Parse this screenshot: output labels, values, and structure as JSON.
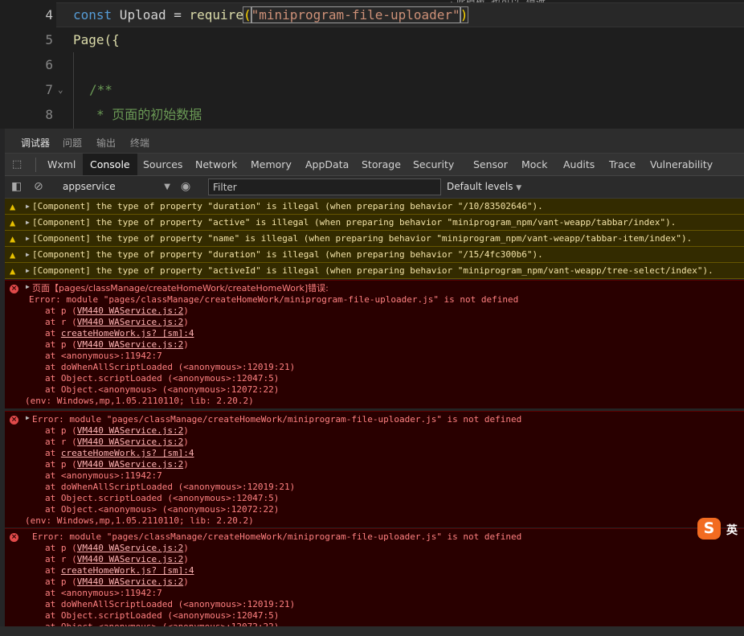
{
  "editor": {
    "top_hint": "· 此模板. 也可以. 值遮",
    "lines": [
      {
        "number": "4",
        "text_parts": [
          "const",
          " Upload",
          " = ",
          "require",
          "(",
          "\"miniprogram-file-uploader\"",
          ")"
        ]
      },
      {
        "number": "5",
        "text": "Page({"
      },
      {
        "number": "6",
        "text": ""
      },
      {
        "number": "7",
        "text": "/**"
      },
      {
        "number": "8",
        "text": "* 页面的初始数据"
      }
    ]
  },
  "panel_tabs": [
    "调试器",
    "问题",
    "输出",
    "终端"
  ],
  "devtools_tabs": [
    "Wxml",
    "Console",
    "Sources",
    "Network",
    "Memory",
    "AppData",
    "Storage",
    "Security",
    "Sensor",
    "Mock",
    "Audits",
    "Trace",
    "Vulnerability"
  ],
  "console_toolbar": {
    "context": "appservice",
    "filter_placeholder": "Filter",
    "levels": "Default levels"
  },
  "warnings": [
    "[Component] the type of property \"duration\" is illegal (when preparing behavior \"/10/83502646\").",
    "[Component] the type of property \"active\" is illegal (when preparing behavior \"miniprogram_npm/vant-weapp/tabbar/index\").",
    "[Component] the type of property \"name\" is illegal (when preparing behavior \"miniprogram_npm/vant-weapp/tabbar-item/index\").",
    "[Component] the type of property \"duration\" is illegal (when preparing behavior \"/15/4fc300b6\").",
    "[Component] the type of property \"activeId\" is illegal (when preparing behavior \"miniprogram_npm/vant-weapp/tree-select/index\")."
  ],
  "errors": {
    "first_header": "页面【pages/classManage/createHomeWork/createHomeWork]错误:",
    "message": "Error: module \"pages/classManage/createHomeWork/miniprogram-file-uploader.js\" is not defined",
    "stack": {
      "p1": "at p (VM440 WAService.js:2)",
      "r1": "at r (VM440 WAService.js:2)",
      "create": "at createHomeWork.js? [sm]:4",
      "p2": "at p (VM440 WAService.js:2)",
      "anon": "at <anonymous>:11942:7",
      "do_when": "at doWhenAllScriptLoaded (<anonymous>:12019:21)",
      "script_loaded": "at Object.scriptLoaded (<anonymous>:12047:5)",
      "object_anon": "at Object.<anonymous> (<anonymous>:12072:22)"
    },
    "env": "(env: Windows,mp,1.05.2110110; lib: 2.20.2)"
  },
  "ime": {
    "logo": "S",
    "label": "英"
  }
}
